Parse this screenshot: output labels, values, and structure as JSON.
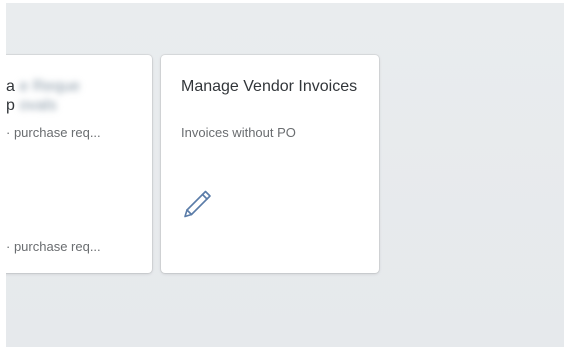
{
  "tiles": [
    {
      "title_line1": "a",
      "title_blur1": "e Reque",
      "title_line2": "p",
      "title_blur2": "ovals",
      "subtitle": "· purchase req...",
      "footer": "· purchase req..."
    },
    {
      "title": "Manage Vendor Invoices",
      "subtitle": "Invoices without PO",
      "icon": "pencil-icon"
    }
  ],
  "colors": {
    "canvas": "#e8ebee",
    "tile": "#ffffff",
    "title_text": "#32363a",
    "subtitle_text": "#6a6d70",
    "icon": "#5a7ca8"
  }
}
